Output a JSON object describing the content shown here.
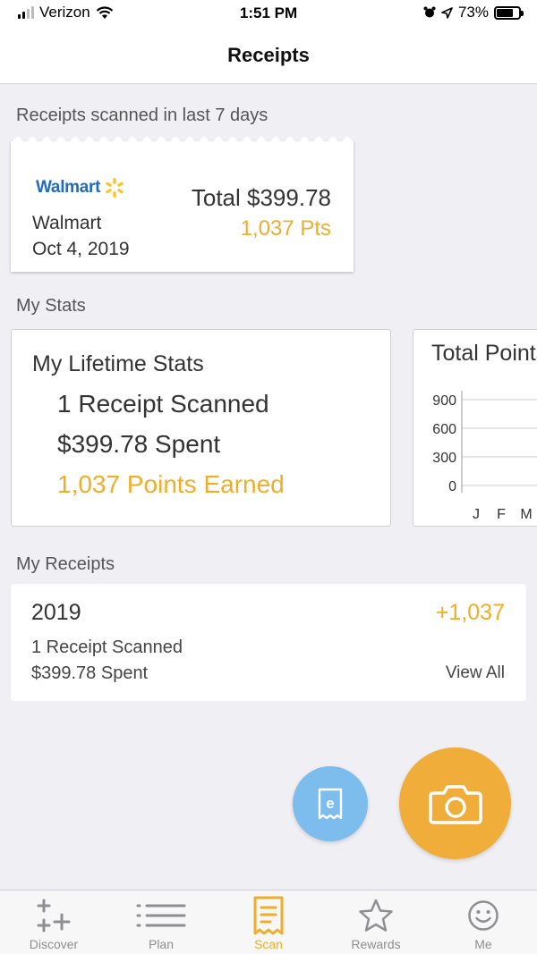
{
  "status_bar": {
    "carrier": "Verizon",
    "time": "1:51 PM",
    "battery": "73%",
    "battery_level": 0.73
  },
  "nav": {
    "title": "Receipts"
  },
  "recent": {
    "label": "Receipts scanned in last 7 days",
    "receipt": {
      "logo_text": "Walmart",
      "store": "Walmart",
      "date": "Oct 4, 2019",
      "total": "Total $399.78",
      "points": "1,037 Pts"
    }
  },
  "stats": {
    "label": "My Stats",
    "lifetime": {
      "title": "My Lifetime Stats",
      "receipts": "1 Receipt Scanned",
      "spent": "$399.78 Spent",
      "points": "1,037 Points Earned"
    },
    "chart": {
      "title": "Total Points",
      "y_ticks": [
        "900",
        "600",
        "300",
        "0"
      ],
      "x_ticks": [
        "J",
        "F",
        "M"
      ]
    }
  },
  "chart_data": {
    "type": "bar",
    "title": "Total Points",
    "categories": [
      "J",
      "F",
      "M"
    ],
    "values": [
      0,
      0,
      0
    ],
    "ylim": [
      0,
      900
    ],
    "y_ticks": [
      0,
      300,
      600,
      900
    ],
    "grid": true
  },
  "my_receipts": {
    "label": "My Receipts",
    "year": "2019",
    "points": "+1,037",
    "receipts": "1 Receipt Scanned",
    "spent": "$399.78 Spent",
    "view_all": "View All"
  },
  "tabs": [
    {
      "label": "Discover",
      "icon": "sparkle-plus-icon",
      "active": false
    },
    {
      "label": "Plan",
      "icon": "list-icon",
      "active": false
    },
    {
      "label": "Scan",
      "icon": "receipt-icon",
      "active": true
    },
    {
      "label": "Rewards",
      "icon": "star-icon",
      "active": false
    },
    {
      "label": "Me",
      "icon": "smiley-icon",
      "active": false
    }
  ],
  "colors": {
    "accent": "#f0ad28",
    "blue_button": "#7dbdee",
    "camera_button": "#f0ad3a",
    "walmart_blue": "#1e6bc2",
    "walmart_yellow": "#ffc220"
  }
}
